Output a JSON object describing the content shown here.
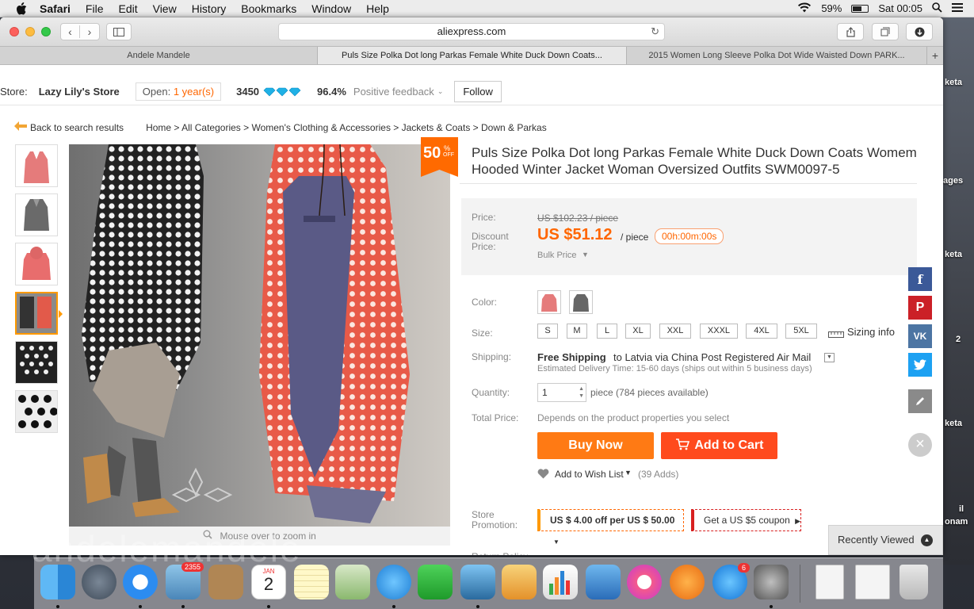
{
  "menubar": {
    "app": "Safari",
    "items": [
      "File",
      "Edit",
      "View",
      "History",
      "Bookmarks",
      "Window",
      "Help"
    ],
    "battery": "59%",
    "clock": "Sat 00:05"
  },
  "browser": {
    "url": "aliexpress.com",
    "tabs": [
      "Andele Mandele",
      "Puls Size Polka Dot long Parkas Female White Duck Down Coats...",
      "2015 Women Long Sleeve Polka Dot Wide Waisted Down PARK..."
    ]
  },
  "store": {
    "label": "Store:",
    "name": "Lazy Lily's Store",
    "open_prefix": "Open:",
    "open_years": "1 year(s)",
    "score": "3450",
    "feedback_pct": "96.4%",
    "feedback_label": "Positive feedback",
    "follow": "Follow"
  },
  "breadcrumb": {
    "back": "Back to search results",
    "path": "Home > All Categories > Women's Clothing & Accessories > Jackets & Coats > Down & Parkas"
  },
  "product": {
    "discount_pct": "50",
    "discount_sym": "%",
    "discount_off": "OFF",
    "title": "Puls Size Polka Dot long Parkas Female White Duck Down Coats Womem Hooded Winter Jacket Woman Oversized Outfits SWM0097-5",
    "zoom_note": "Mouse over to zoom in"
  },
  "pricing": {
    "price_label": "Price:",
    "old_price": "US $102.23 / piece",
    "discount_label_1": "Discount",
    "discount_label_2": "Price:",
    "price": "US $51.12",
    "unit": "/ piece",
    "timer": "00h:00m:00s",
    "bulk": "Bulk Price"
  },
  "options": {
    "color_label": "Color:",
    "size_label": "Size:",
    "sizes": [
      "S",
      "M",
      "L",
      "XL",
      "XXL",
      "XXXL",
      "4XL",
      "5XL"
    ],
    "sizing_info": "Sizing info",
    "shipping_label": "Shipping:",
    "shipping_free": "Free Shipping",
    "shipping_to": "to Latvia via China Post Registered Air Mail",
    "delivery": "Estimated Delivery Time: 15-60 days (ships out within 5 business days)",
    "quantity_label": "Quantity:",
    "quantity": "1",
    "available": "piece (784 pieces available)",
    "total_label": "Total Price:",
    "total_value": "Depends on the product properties you select"
  },
  "actions": {
    "buy_now": "Buy Now",
    "add_to_cart": "Add to Cart",
    "wishlist": "Add to Wish List",
    "adds": "(39 Adds)"
  },
  "promotion": {
    "label_1": "Store",
    "label_2": "Promotion:",
    "offer": "US $ 4.00 off per US $ 50.00",
    "coupon": "Get a US $5 coupon"
  },
  "return_policy": "Return Policy",
  "recently_viewed": "Recently Viewed",
  "watermark": "andelemandele",
  "desktop_labels": [
    "keta",
    "ages",
    "keta",
    "2",
    "keta",
    "il",
    "onam"
  ],
  "dock": {
    "mail_badge": "2355",
    "calendar_month": "JAN",
    "calendar_day": "2",
    "appstore_badge": "6"
  },
  "colors": {
    "accent": "#ff6a00",
    "price": "#f60",
    "facebook": "#3b5998",
    "pinterest": "#cb2027",
    "vk": "#4c75a3",
    "twitter": "#1da1f2"
  }
}
